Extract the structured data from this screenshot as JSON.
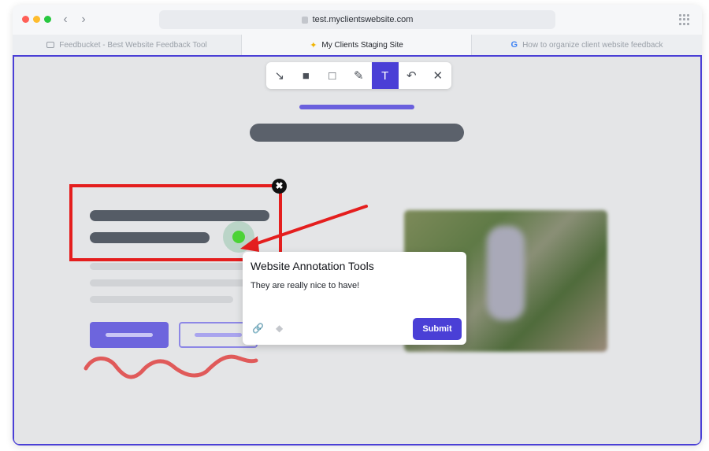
{
  "browser": {
    "url": "test.myclientswebsite.com",
    "tabs": [
      {
        "label": "Feedbucket - Best Website Feedback Tool",
        "icon": "video-icon",
        "active": false
      },
      {
        "label": "My Clients Staging Site",
        "icon": "sparkle-icon",
        "active": true
      },
      {
        "label": "How to organize client website feedback",
        "icon": "google-icon",
        "active": false
      }
    ],
    "traffic_lights": [
      "#ff5f57",
      "#febc2e",
      "#28c840"
    ]
  },
  "toolbar": {
    "tools": [
      {
        "name": "arrow-tool",
        "glyph": "↘"
      },
      {
        "name": "filled-rect-tool",
        "glyph": "■"
      },
      {
        "name": "rect-tool",
        "glyph": "□"
      },
      {
        "name": "pen-tool",
        "glyph": "✎"
      },
      {
        "name": "text-tool",
        "glyph": "T",
        "active": true
      },
      {
        "name": "undo-tool",
        "glyph": "↶"
      },
      {
        "name": "close-tool",
        "glyph": "✕"
      }
    ]
  },
  "popup": {
    "title": "Website Annotation Tools",
    "comment": "They are really nice to have!",
    "submit_label": "Submit",
    "attach_icon": "paperclip-icon",
    "tag_icon": "tag-icon"
  },
  "annotation": {
    "close_glyph": "✖",
    "color": "#e41e1e",
    "accent": "#4a3fd6"
  }
}
